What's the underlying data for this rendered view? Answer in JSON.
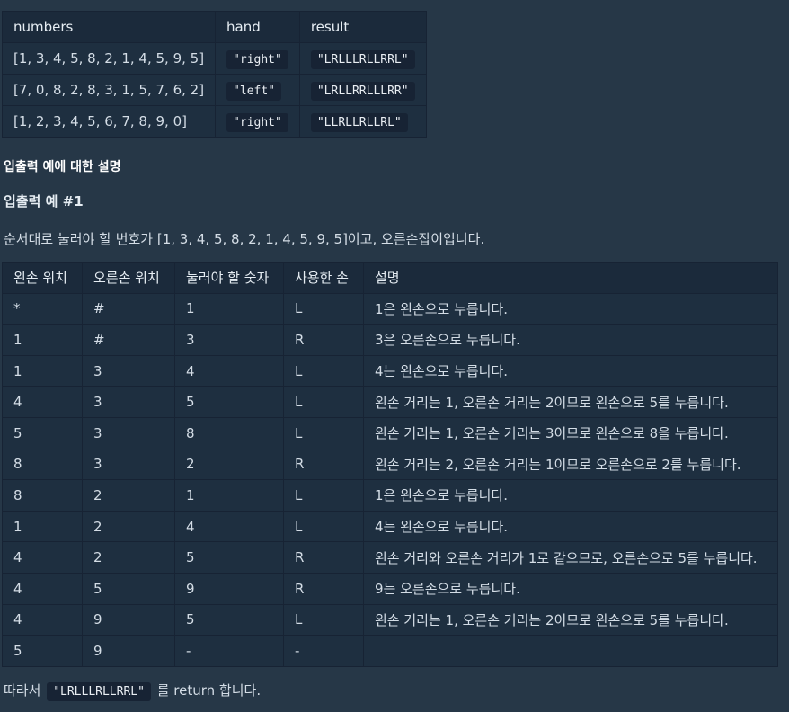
{
  "io_table": {
    "headers": [
      "numbers",
      "hand",
      "result"
    ],
    "rows": [
      {
        "numbers": "[1, 3, 4, 5, 8, 2, 1, 4, 5, 9, 5]",
        "hand": "\"right\"",
        "result": "\"LRLLLRLLRRL\""
      },
      {
        "numbers": "[7, 0, 8, 2, 8, 3, 1, 5, 7, 6, 2]",
        "hand": "\"left\"",
        "result": "\"LRLLRRLLLRR\""
      },
      {
        "numbers": "[1, 2, 3, 4, 5, 6, 7, 8, 9, 0]",
        "hand": "\"right\"",
        "result": "\"LLRLLRLLRL\""
      }
    ]
  },
  "explanation_heading": "입출력 예에 대한 설명",
  "example1_heading": "입출력 예 #1",
  "example1_desc": "순서대로 눌러야 할 번호가 [1, 3, 4, 5, 8, 2, 1, 4, 5, 9, 5]이고, 오른손잡이입니다.",
  "steps_table": {
    "headers": [
      "왼손 위치",
      "오른손 위치",
      "눌러야 할 숫자",
      "사용한 손",
      "설명"
    ],
    "rows": [
      [
        "*",
        "#",
        "1",
        "L",
        "1은 왼손으로 누릅니다."
      ],
      [
        "1",
        "#",
        "3",
        "R",
        "3은 오른손으로 누릅니다."
      ],
      [
        "1",
        "3",
        "4",
        "L",
        "4는 왼손으로 누릅니다."
      ],
      [
        "4",
        "3",
        "5",
        "L",
        "왼손 거리는 1, 오른손 거리는 2이므로 왼손으로 5를 누릅니다."
      ],
      [
        "5",
        "3",
        "8",
        "L",
        "왼손 거리는 1, 오른손 거리는 3이므로 왼손으로 8을 누릅니다."
      ],
      [
        "8",
        "3",
        "2",
        "R",
        "왼손 거리는 2, 오른손 거리는 1이므로 오른손으로 2를 누릅니다."
      ],
      [
        "8",
        "2",
        "1",
        "L",
        "1은 왼손으로 누릅니다."
      ],
      [
        "1",
        "2",
        "4",
        "L",
        "4는 왼손으로 누릅니다."
      ],
      [
        "4",
        "2",
        "5",
        "R",
        "왼손 거리와 오른손 거리가 1로 같으므로, 오른손으로 5를 누릅니다."
      ],
      [
        "4",
        "5",
        "9",
        "R",
        "9는 오른손으로 누릅니다."
      ],
      [
        "4",
        "9",
        "5",
        "L",
        "왼손 거리는 1, 오른손 거리는 2이므로 왼손으로 5를 누릅니다."
      ],
      [
        "5",
        "9",
        "-",
        "-",
        ""
      ]
    ]
  },
  "result_line": {
    "prefix": "따라서",
    "code": "\"LRLLLRLLRRL\"",
    "suffix": "를 return 합니다."
  }
}
